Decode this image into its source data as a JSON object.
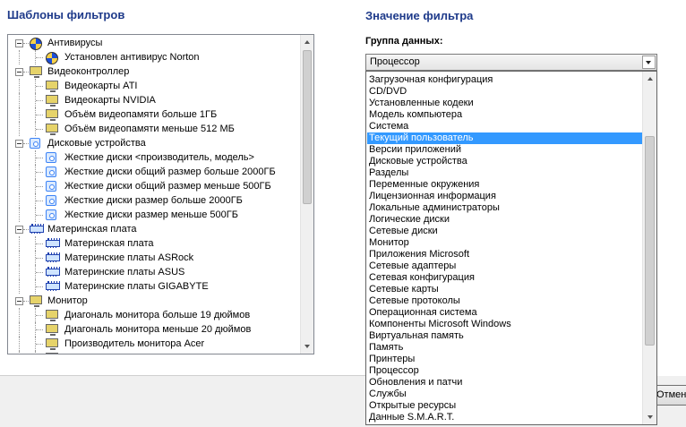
{
  "left_panel": {
    "heading": "Шаблоны фильтров"
  },
  "right_panel": {
    "heading": "Значение фильтра",
    "group_label": "Группа данных:",
    "selected_value": "Процессор"
  },
  "tree": [
    {
      "label": "Антивирусы",
      "icon": "shield-icon",
      "level": 0,
      "expanded": true
    },
    {
      "label": "Установлен антивирус Norton",
      "icon": "shield-icon",
      "level": 1
    },
    {
      "label": "Видеоконтроллер",
      "icon": "monitor-icon",
      "level": 0,
      "expanded": true
    },
    {
      "label": "Видеокарты ATI",
      "icon": "monitor-icon",
      "level": 1
    },
    {
      "label": "Видеокарты NVIDIA",
      "icon": "monitor-icon",
      "level": 1
    },
    {
      "label": "Объём видеопамяти больше 1ГБ",
      "icon": "monitor-icon",
      "level": 1
    },
    {
      "label": "Объём видеопамяти меньше 512 МБ",
      "icon": "monitor-icon",
      "level": 1
    },
    {
      "label": "Дисковые устройства",
      "icon": "disk-icon",
      "level": 0,
      "expanded": true
    },
    {
      "label": "Жесткие диски <производитель, модель>",
      "icon": "disk-icon",
      "level": 1
    },
    {
      "label": "Жесткие диски общий размер больше 2000ГБ",
      "icon": "disk-icon",
      "level": 1
    },
    {
      "label": "Жесткие диски общий размер меньше 500ГБ",
      "icon": "disk-icon",
      "level": 1
    },
    {
      "label": "Жесткие диски размер больше 2000ГБ",
      "icon": "disk-icon",
      "level": 1
    },
    {
      "label": "Жесткие диски размер меньше 500ГБ",
      "icon": "disk-icon",
      "level": 1
    },
    {
      "label": "Материнская плата",
      "icon": "motherboard-icon",
      "level": 0,
      "expanded": true
    },
    {
      "label": "Материнская плата",
      "icon": "motherboard-icon",
      "level": 1
    },
    {
      "label": "Материнские платы ASRock",
      "icon": "motherboard-icon",
      "level": 1
    },
    {
      "label": "Материнские платы ASUS",
      "icon": "motherboard-icon",
      "level": 1
    },
    {
      "label": "Материнские платы GIGABYTE",
      "icon": "motherboard-icon",
      "level": 1
    },
    {
      "label": "Монитор",
      "icon": "monitor-icon",
      "level": 0,
      "expanded": true
    },
    {
      "label": "Диагональ монитора больше 19 дюймов",
      "icon": "monitor-icon",
      "level": 1
    },
    {
      "label": "Диагональ монитора меньше 20 дюймов",
      "icon": "monitor-icon",
      "level": 1
    },
    {
      "label": "Производитель монитора Acer",
      "icon": "monitor-icon",
      "level": 1
    },
    {
      "label": "",
      "icon": "monitor-icon",
      "level": 1
    }
  ],
  "dropdown_items": [
    "Загрузочная конфигурация",
    "CD/DVD",
    "Установленные кодеки",
    "Модель компьютера",
    "Система",
    "Текущий пользователь",
    "Версии приложений",
    "Дисковые устройства",
    "Разделы",
    "Переменные окружения",
    "Лицензионная информация",
    "Локальные администраторы",
    "Логические диски",
    "Сетевые диски",
    "Монитор",
    "Приложения Microsoft",
    "Сетевые адаптеры",
    "Сетевая конфигурация",
    "Сетевые карты",
    "Сетевые протоколы",
    "Операционная система",
    "Компоненты Microsoft Windows",
    "Виртуальная память",
    "Память",
    "Принтеры",
    "Процессор",
    "Обновления и патчи",
    "Службы",
    "Открытые ресурсы",
    "Данные S.M.A.R.T."
  ],
  "dropdown_selected": "Текущий пользователь",
  "footer": {
    "cancel_label": "Отмена"
  }
}
